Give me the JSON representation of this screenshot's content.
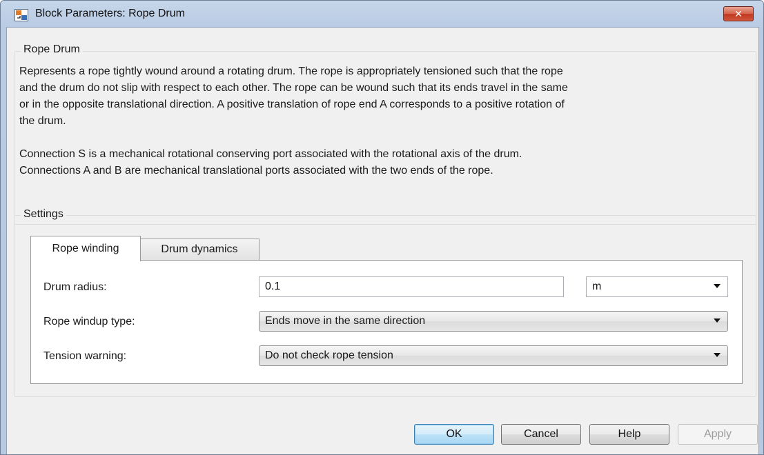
{
  "window": {
    "title": "Block Parameters: Rope Drum",
    "close_glyph": "✕"
  },
  "description_group": {
    "label": "Rope Drum",
    "text": "Represents a rope tightly wound around a rotating drum. The rope is appropriately tensioned such that the rope\nand the drum do not slip with respect to each other. The rope can be wound such that its ends travel in the same\nor in the opposite translational direction. A positive translation of rope end A corresponds to a positive rotation of\nthe drum.\n\nConnection S is a mechanical rotational conserving port associated with the rotational axis of the drum.\nConnections A and B are mechanical translational ports associated with the two ends of the rope."
  },
  "settings": {
    "label": "Settings",
    "tabs": [
      {
        "label": "Rope winding",
        "active": true
      },
      {
        "label": "Drum dynamics",
        "active": false
      }
    ],
    "params": {
      "drum_radius": {
        "label": "Drum radius:",
        "value": "0.1",
        "unit": "m"
      },
      "windup_type": {
        "label": "Rope windup type:",
        "value": "Ends move in the same direction"
      },
      "tension_warning": {
        "label": "Tension warning:",
        "value": "Do not check rope tension"
      }
    }
  },
  "buttons": {
    "ok": "OK",
    "cancel": "Cancel",
    "help": "Help",
    "apply": "Apply"
  },
  "colors": {
    "titlebar": "#b8cbe3",
    "close_button": "#c0381f",
    "dialog_bg": "#f0f0f0",
    "default_button_border": "#3c7fb1"
  }
}
